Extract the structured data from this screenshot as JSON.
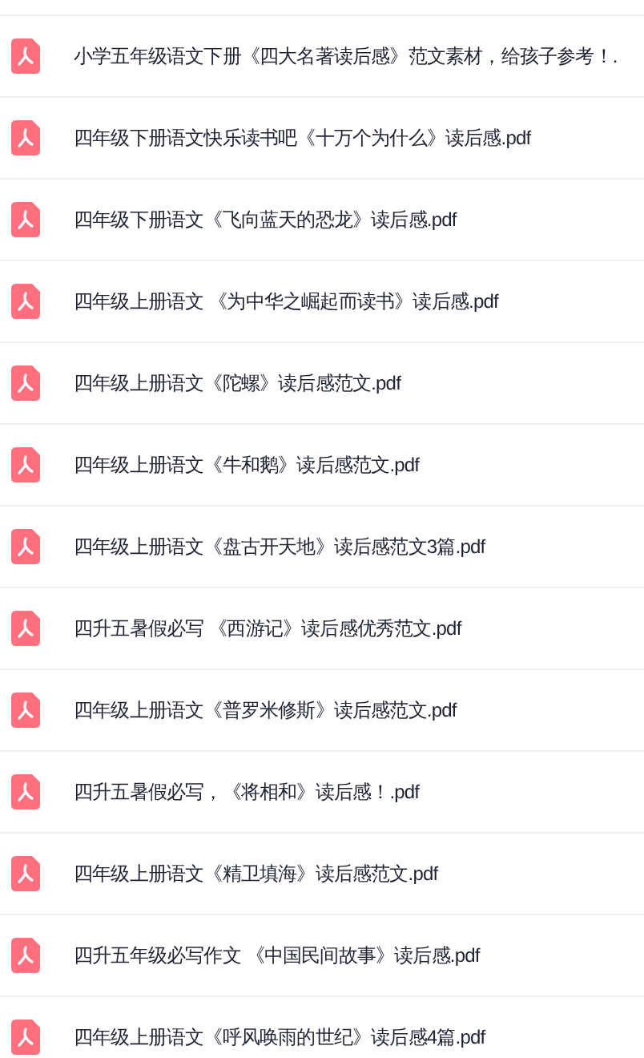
{
  "files": [
    {
      "name": "小学五年级语文下册《四大名著读后感》范文素材，给孩子参考！."
    },
    {
      "name": "四年级下册语文快乐读书吧《十万个为什么》读后感.pdf"
    },
    {
      "name": "四年级下册语文《飞向蓝天的恐龙》读后感.pdf"
    },
    {
      "name": "四年级上册语文 《为中华之崛起而读书》读后感.pdf"
    },
    {
      "name": "四年级上册语文《陀螺》读后感范文.pdf"
    },
    {
      "name": "四年级上册语文《牛和鹅》读后感范文.pdf"
    },
    {
      "name": "四年级上册语文《盘古开天地》读后感范文3篇.pdf"
    },
    {
      "name": "四升五暑假必写 《西游记》读后感优秀范文.pdf"
    },
    {
      "name": "四年级上册语文《普罗米修斯》读后感范文.pdf"
    },
    {
      "name": "四升五暑假必写，《将相和》读后感！.pdf"
    },
    {
      "name": "四年级上册语文《精卫填海》读后感范文.pdf"
    },
    {
      "name": "四升五年级必写作文 《中国民间故事》读后感.pdf"
    },
    {
      "name": "四年级上册语文《呼风唤雨的世纪》读后感4篇.pdf"
    }
  ]
}
